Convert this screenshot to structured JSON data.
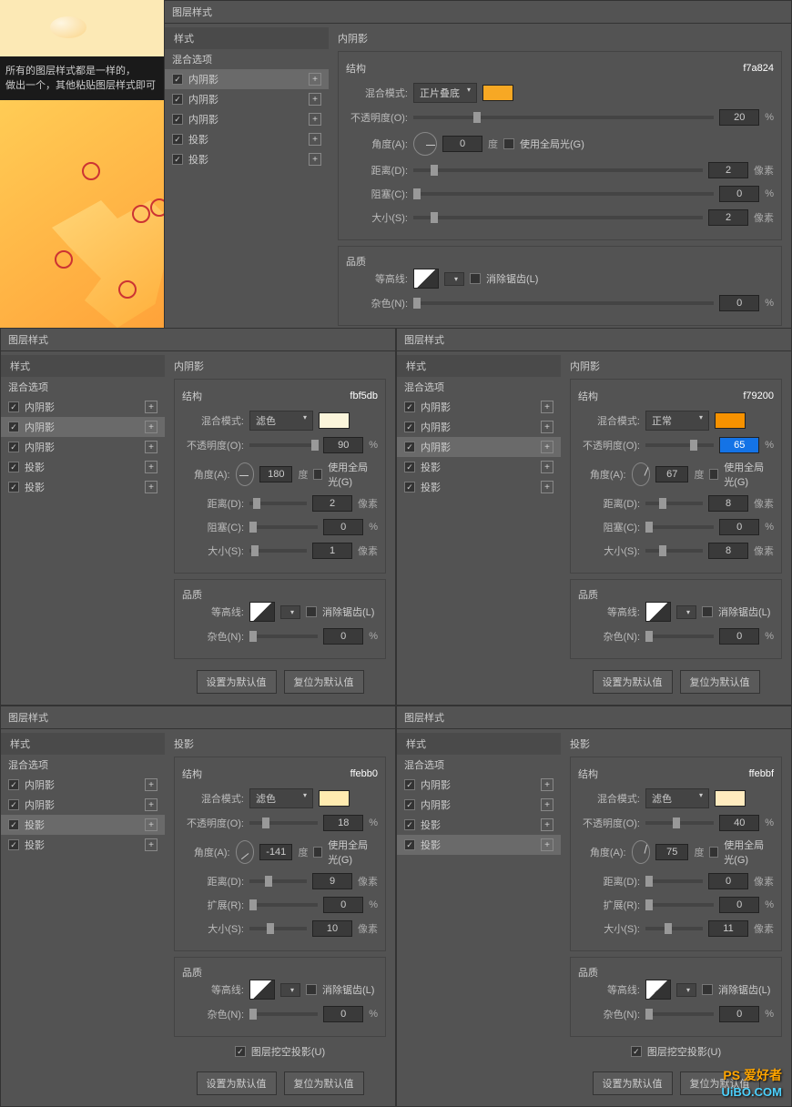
{
  "caption_line1": "所有的图层样式都是一样的，",
  "caption_line2": "做出一个，其他粘贴图层样式即可",
  "panel_title": "图层样式",
  "styles_header": "样式",
  "blend_options": "混合选项",
  "effect": {
    "inner_shadow": "内阴影",
    "drop_shadow": "投影"
  },
  "labels": {
    "section_inner": "内阴影",
    "section_drop": "投影",
    "structure": "结构",
    "quality": "品质",
    "blend_mode": "混合模式:",
    "opacity": "不透明度(O):",
    "angle": "角度(A):",
    "degree": "度",
    "global_light": "使用全局光(G)",
    "distance": "距离(D):",
    "choke": "阻塞(C):",
    "spread": "扩展(R):",
    "size": "大小(S):",
    "px": "像素",
    "pct": "%",
    "contour": "等高线:",
    "antialias": "消除锯齿(L)",
    "noise": "杂色(N):",
    "knockout": "图层挖空投影(U)",
    "default": "设置为默认值",
    "reset": "复位为默认值"
  },
  "modes": {
    "multiply": "正片叠底",
    "screen": "滤色",
    "normal": "正常"
  },
  "panels": [
    {
      "section": "inner",
      "hex": "f7a824",
      "swatch": "#f7a824",
      "mode": "multiply",
      "opacity": 20,
      "angle": 0,
      "distance": 2,
      "choke": 0,
      "size": 2,
      "noise": 0,
      "styles": [
        "inner",
        "inner",
        "inner",
        "drop",
        "drop"
      ],
      "active": 0
    },
    {
      "section": "inner",
      "hex": "fbf5db",
      "swatch": "#fbf5db",
      "mode": "screen",
      "opacity": 90,
      "angle": 180,
      "distance": 2,
      "choke": 0,
      "size": 1,
      "noise": 0,
      "styles": [
        "inner",
        "inner",
        "inner",
        "drop",
        "drop"
      ],
      "active": 1
    },
    {
      "section": "inner",
      "hex": "f79200",
      "swatch": "#f79200",
      "mode": "normal",
      "opacity": 65,
      "angle": 67,
      "distance": 8,
      "choke": 0,
      "size": 8,
      "noise": 0,
      "styles": [
        "inner",
        "inner",
        "inner",
        "drop",
        "drop"
      ],
      "active": 2,
      "opacity_hl": true
    },
    {
      "section": "drop",
      "hex": "ffebb0",
      "swatch": "#ffebb0",
      "mode": "screen",
      "opacity": 18,
      "angle": -141,
      "distance": 9,
      "spread": 0,
      "size": 10,
      "noise": 0,
      "knockout": true,
      "styles": [
        "inner",
        "inner",
        "drop",
        "drop"
      ],
      "active": 2
    },
    {
      "section": "drop",
      "hex": "ffebbf",
      "swatch": "#ffebbf",
      "mode": "screen",
      "opacity": 40,
      "angle": 75,
      "distance": 0,
      "spread": 0,
      "size": 11,
      "noise": 0,
      "knockout": true,
      "styles": [
        "inner",
        "inner",
        "drop",
        "drop"
      ],
      "active": 3
    }
  ],
  "watermark1": "PS 爱好者",
  "watermark2": "UiBO.COM"
}
